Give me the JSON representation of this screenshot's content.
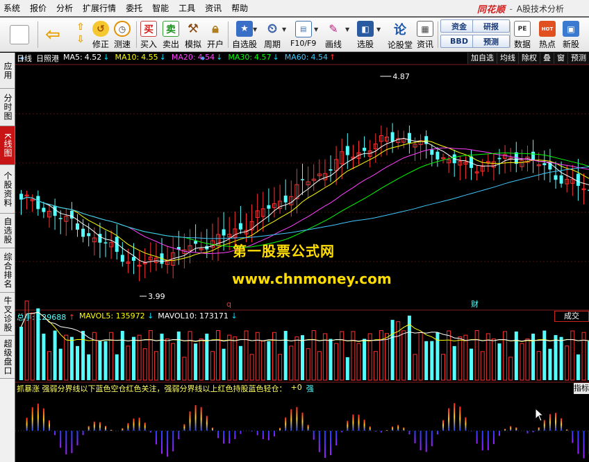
{
  "menu": [
    "系统",
    "报价",
    "分析",
    "扩展行情",
    "委托",
    "智能",
    "工具",
    "资讯",
    "帮助"
  ],
  "brand": {
    "logo": "同花顺",
    "sep": "-",
    "title": "A股技术分析"
  },
  "toolbar": {
    "buttons": [
      {
        "label": "修正",
        "icon": "fix-icon"
      },
      {
        "label": "测速",
        "icon": "clock-icon"
      },
      {
        "label": "买入",
        "icon": "buy-icon",
        "glyph": "买"
      },
      {
        "label": "卖出",
        "icon": "sell-icon",
        "glyph": "卖"
      },
      {
        "label": "模拟",
        "icon": "gavel-icon"
      },
      {
        "label": "开户",
        "icon": "lock-icon"
      },
      {
        "label": "自选股",
        "icon": "star-icon"
      },
      {
        "label": "周期",
        "icon": "cycle-icon"
      },
      {
        "label": "F10/F9",
        "icon": "f10-icon"
      },
      {
        "label": "画线",
        "icon": "pencil-icon"
      },
      {
        "label": "选股",
        "icon": "screen-icon"
      },
      {
        "label": "论股堂",
        "icon": "forum-icon",
        "glyph": "论"
      },
      {
        "label": "资讯",
        "icon": "news-icon"
      },
      {
        "label": "数据",
        "icon": "pe-icon",
        "glyph": "PE"
      },
      {
        "label": "热点",
        "icon": "hot-icon",
        "glyph": "HOT"
      },
      {
        "label": "新股",
        "icon": "newstock-icon"
      }
    ],
    "mini": [
      "资金",
      "研报",
      "BBD",
      "预测"
    ]
  },
  "sidetabs": [
    "应用",
    "分时图",
    "K线图",
    "个股资料",
    "自选股",
    "综合排名",
    "牛叉诊股",
    "超级盘口"
  ],
  "price_info": {
    "period": "日线",
    "name": "日照港",
    "ma": [
      {
        "label": "MA5:",
        "value": "4.52",
        "dir": "down",
        "color": "#ffffff"
      },
      {
        "label": "MA10:",
        "value": "4.55",
        "dir": "down",
        "color": "#ffff00"
      },
      {
        "label": "MA20:",
        "value": "4.54",
        "dir": "down",
        "color": "#ff40ff"
      },
      {
        "label": "MA30:",
        "value": "4.57",
        "dir": "down",
        "color": "#00ff00"
      },
      {
        "label": "MA60:",
        "value": "4.54",
        "dir": "up",
        "color": "#40c8ff"
      }
    ]
  },
  "right_btns": [
    "加自选",
    "均线",
    "除权",
    "叠",
    "窗",
    "预测"
  ],
  "vol_info": {
    "total": {
      "label": "总手:",
      "value": "129688",
      "dir": "up"
    },
    "mavol5": {
      "label": "MAVOL5:",
      "value": "135972",
      "dir": "down"
    },
    "mavol10": {
      "label": "MAVOL10:",
      "value": "173171",
      "dir": "down"
    }
  },
  "vol_btn": "成交",
  "ind_btn": "指标",
  "ind_info": {
    "text": "抓暴涨  强弱分界线以下蓝色空仓红色关注，强弱分界线以上红色持股蓝色轻仓：",
    "value": "+0",
    "tag": "强"
  },
  "annotations": {
    "high": "4.87",
    "low": "3.99",
    "q_marker": "q",
    "cai_marker": "财"
  },
  "watermark": {
    "line1": "第一股票公式网",
    "line2": "www.chnmoney.com"
  },
  "chart_data": {
    "type": "candlestick",
    "symbol": "日照港",
    "period": "日线",
    "high_mark": 4.87,
    "low_mark": 3.99,
    "ma_last": {
      "MA5": 4.52,
      "MA10": 4.55,
      "MA20": 4.54,
      "MA30": 4.57,
      "MA60": 4.54
    },
    "volume_last": {
      "总手": 129688,
      "MAVOL5": 135972,
      "MAVOL10": 173171
    },
    "colors": {
      "up": "#ff3232",
      "down": "#54ffff",
      "background": "#000000"
    }
  }
}
